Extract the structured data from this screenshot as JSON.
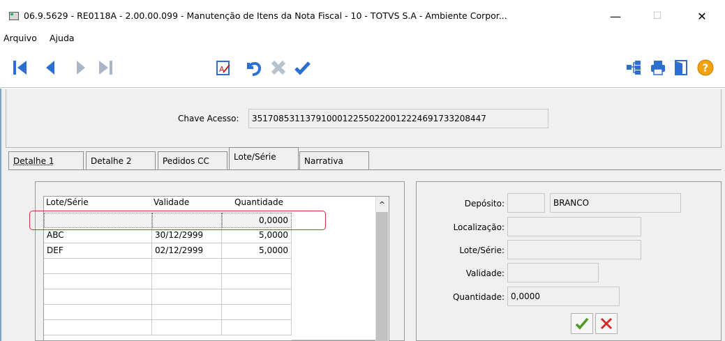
{
  "window": {
    "title": "06.9.5629 - RE0118A - 2.00.00.099 - Manutenção de Itens da Nota Fiscal - 10 - TOTVS S.A - Ambiente Corpor...",
    "min_glyph": "—",
    "max_glyph": "☐",
    "close_glyph": "✕"
  },
  "menu": {
    "items": [
      "Arquivo",
      "Ajuda"
    ]
  },
  "toolbar": {
    "nav_icons": [
      "first-record-icon",
      "previous-record-icon",
      "next-record-icon",
      "last-record-icon"
    ],
    "edit_icons": [
      "edit-document-icon",
      "undo-icon",
      "delete-icon",
      "confirm-icon"
    ],
    "right_icons": [
      "hierarchy-icon",
      "print-icon",
      "exit-door-icon",
      "help-icon"
    ],
    "accent": "#1f5fbf"
  },
  "header": {
    "chave_label": "Chave Acesso:",
    "chave_value": "35170853113791000122550220012224691733208447"
  },
  "tabs": [
    {
      "label": "Detalhe 1",
      "active": false
    },
    {
      "label": "Detalhe 2",
      "active": false
    },
    {
      "label": "Pedidos CC",
      "active": false
    },
    {
      "label": "Lote/Série",
      "active": true
    },
    {
      "label": "Narrativa",
      "active": false
    }
  ],
  "grid": {
    "columns": [
      "Lote/Série",
      "Validade",
      "Quantidade"
    ],
    "rows": [
      [
        "",
        "",
        "0,0000"
      ],
      [
        "ABC",
        "30/12/2999",
        "5,0000"
      ],
      [
        "DEF",
        "02/12/2999",
        "5,0000"
      ],
      [
        "",
        "",
        ""
      ],
      [
        "",
        "",
        ""
      ],
      [
        "",
        "",
        ""
      ],
      [
        "",
        "",
        ""
      ],
      [
        "",
        "",
        ""
      ]
    ],
    "scroll_up_glyph": "^",
    "highlight_color": "#d9302f"
  },
  "detail": {
    "deposito_label": "Depósito:",
    "deposito_code": "",
    "deposito_name": "BRANCO",
    "localizacao_label": "Localização:",
    "localizacao_value": "",
    "lote_label": "Lote/Série:",
    "lote_value": "",
    "validade_label": "Validade:",
    "validade_value": "",
    "quantidade_label": "Quantidade:",
    "quantidade_value": "0,0000",
    "ok_icon": "green-check-icon",
    "cancel_icon": "red-x-icon"
  }
}
